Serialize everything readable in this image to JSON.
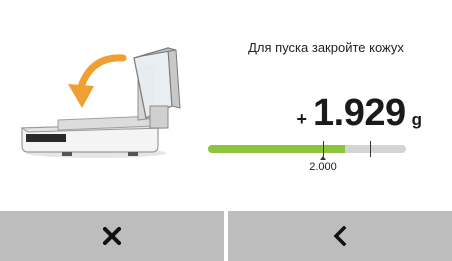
{
  "message": "Для пуска закройте кожух",
  "weight": {
    "sign": "+",
    "value": "1.929",
    "unit": "g"
  },
  "target": {
    "label": "2.000",
    "fill_fraction": 0.69,
    "target_fraction": 0.58,
    "tolerance_fraction": 0.82
  },
  "colors": {
    "progress": "#8cc43e",
    "track": "#d4d4d4",
    "button": "#bdbdbd",
    "arrow": "#f0a030"
  },
  "buttons": {
    "cancel_icon": "close-icon",
    "back_icon": "chevron-left-icon"
  }
}
